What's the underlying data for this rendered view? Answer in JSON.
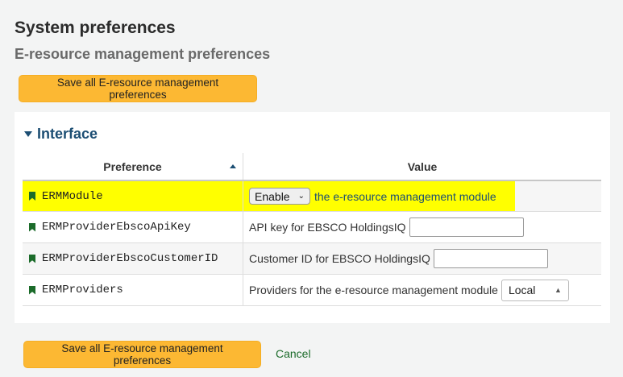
{
  "page": {
    "title": "System preferences",
    "subtitle": "E-resource management preferences"
  },
  "buttons": {
    "save_all_label": "Save all E-resource management preferences",
    "cancel_label": "Cancel"
  },
  "section": {
    "heading": "Interface"
  },
  "table": {
    "columns": [
      "Preference",
      "Value"
    ],
    "rows": [
      {
        "name": "ERMModule",
        "select_value": "Enable",
        "text_after": "the e-resource management module",
        "highlighted": true
      },
      {
        "name": "ERMProviderEbscoApiKey",
        "label": "API key for EBSCO HoldingsIQ",
        "input_value": ""
      },
      {
        "name": "ERMProviderEbscoCustomerID",
        "label": "Customer ID for EBSCO HoldingsIQ",
        "input_value": ""
      },
      {
        "name": "ERMProviders",
        "label": "Providers for the e-resource management module",
        "select_value": "Local"
      }
    ]
  },
  "colors": {
    "save_button": "#fcb833",
    "heading_blue": "#1c4e73",
    "bookmark_green": "#1b6b2a",
    "highlight": "#ffff00",
    "link_green": "#1b6b2a"
  }
}
